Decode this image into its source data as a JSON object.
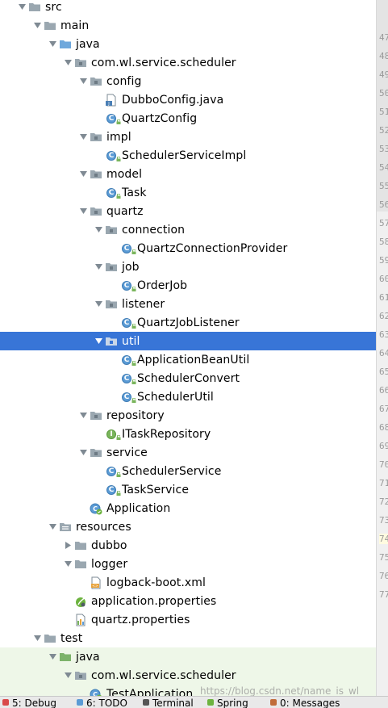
{
  "tree": [
    {
      "label": "src",
      "icon": "folder-icon",
      "arrow": "down",
      "indent": 0
    },
    {
      "label": "main",
      "icon": "folder-icon",
      "arrow": "down",
      "indent": 1
    },
    {
      "label": "java",
      "icon": "source-folder-icon",
      "arrow": "down",
      "indent": 2
    },
    {
      "label": "com.wl.service.scheduler",
      "icon": "package-icon",
      "arrow": "down",
      "indent": 3
    },
    {
      "label": "config",
      "icon": "package-icon",
      "arrow": "down",
      "indent": 4
    },
    {
      "label": "DubboConfig.java",
      "icon": "java-file-icon",
      "arrow": "none",
      "indent": 5
    },
    {
      "label": "QuartzConfig",
      "icon": "class-icon",
      "arrow": "none",
      "indent": 5
    },
    {
      "label": "impl",
      "icon": "package-icon",
      "arrow": "down",
      "indent": 4
    },
    {
      "label": "SchedulerServiceImpl",
      "icon": "class-icon",
      "arrow": "none",
      "indent": 5
    },
    {
      "label": "model",
      "icon": "package-icon",
      "arrow": "down",
      "indent": 4
    },
    {
      "label": "Task",
      "icon": "class-icon",
      "arrow": "none",
      "indent": 5
    },
    {
      "label": "quartz",
      "icon": "package-icon",
      "arrow": "down",
      "indent": 4
    },
    {
      "label": "connection",
      "icon": "package-icon",
      "arrow": "down",
      "indent": 5
    },
    {
      "label": "QuartzConnectionProvider",
      "icon": "class-icon",
      "arrow": "none",
      "indent": 6
    },
    {
      "label": "job",
      "icon": "package-icon",
      "arrow": "down",
      "indent": 5
    },
    {
      "label": "OrderJob",
      "icon": "class-icon",
      "arrow": "none",
      "indent": 6
    },
    {
      "label": "listener",
      "icon": "package-icon",
      "arrow": "down",
      "indent": 5
    },
    {
      "label": "QuartzJobListener",
      "icon": "class-icon",
      "arrow": "none",
      "indent": 6
    },
    {
      "label": "util",
      "icon": "package-icon",
      "arrow": "down",
      "indent": 5,
      "selected": true
    },
    {
      "label": "ApplicationBeanUtil",
      "icon": "class-icon",
      "arrow": "none",
      "indent": 6
    },
    {
      "label": "SchedulerConvert",
      "icon": "class-icon",
      "arrow": "none",
      "indent": 6
    },
    {
      "label": "SchedulerUtil",
      "icon": "class-icon",
      "arrow": "none",
      "indent": 6
    },
    {
      "label": "repository",
      "icon": "package-icon",
      "arrow": "down",
      "indent": 4
    },
    {
      "label": "ITaskRepository",
      "icon": "interface-icon",
      "arrow": "none",
      "indent": 5
    },
    {
      "label": "service",
      "icon": "package-icon",
      "arrow": "down",
      "indent": 4
    },
    {
      "label": "SchedulerService",
      "icon": "class-icon",
      "arrow": "none",
      "indent": 5
    },
    {
      "label": "TaskService",
      "icon": "class-icon",
      "arrow": "none",
      "indent": 5
    },
    {
      "label": "Application",
      "icon": "spring-boot-app-icon",
      "arrow": "none",
      "indent": 4
    },
    {
      "label": "resources",
      "icon": "resources-folder-icon",
      "arrow": "down",
      "indent": 2
    },
    {
      "label": "dubbo",
      "icon": "folder-icon",
      "arrow": "right",
      "indent": 3
    },
    {
      "label": "logger",
      "icon": "folder-icon",
      "arrow": "down",
      "indent": 3
    },
    {
      "label": "logback-boot.xml",
      "icon": "xml-file-icon",
      "arrow": "none",
      "indent": 4
    },
    {
      "label": "application.properties",
      "icon": "spring-properties-icon",
      "arrow": "none",
      "indent": 3
    },
    {
      "label": "quartz.properties",
      "icon": "properties-file-icon",
      "arrow": "none",
      "indent": 3
    },
    {
      "label": "test",
      "icon": "folder-icon",
      "arrow": "down",
      "indent": 1
    },
    {
      "label": "java",
      "icon": "test-folder-icon",
      "arrow": "down",
      "indent": 2,
      "test": true
    },
    {
      "label": "com.wl.service.scheduler",
      "icon": "package-icon",
      "arrow": "down",
      "indent": 3,
      "test": true
    },
    {
      "label": "TestApplication",
      "icon": "spring-boot-app-icon",
      "arrow": "none",
      "indent": 4,
      "test": true
    }
  ],
  "gutter_lines": [
    "47",
    "48",
    "49",
    "50",
    "51",
    "52",
    "53",
    "54",
    "55",
    "56",
    "57",
    "58",
    "59",
    "60",
    "61",
    "62",
    "63",
    "64",
    "65",
    "66",
    "67",
    "68",
    "69",
    "70",
    "71",
    "72",
    "73",
    "74",
    "75",
    "76",
    "77"
  ],
  "gutter_highlight": "74",
  "bottom_toolwindows": [
    {
      "label": "5: Debug",
      "icon": "debug-icon"
    },
    {
      "label": "6: TODO",
      "icon": "todo-icon"
    },
    {
      "label": "Terminal",
      "icon": "terminal-icon"
    },
    {
      "label": "Spring",
      "icon": "spring-icon"
    },
    {
      "label": "0: Messages",
      "icon": "messages-icon"
    }
  ],
  "watermark": "https://blog.csdn.net/name_is_wl",
  "colors": {
    "selection": "#3875d7",
    "class_icon": "#5b9bd5",
    "interface_icon": "#7ab55c",
    "folder": "#9aa7b0",
    "source_folder": "#6fa8dc",
    "test_folder": "#7cb36a"
  }
}
